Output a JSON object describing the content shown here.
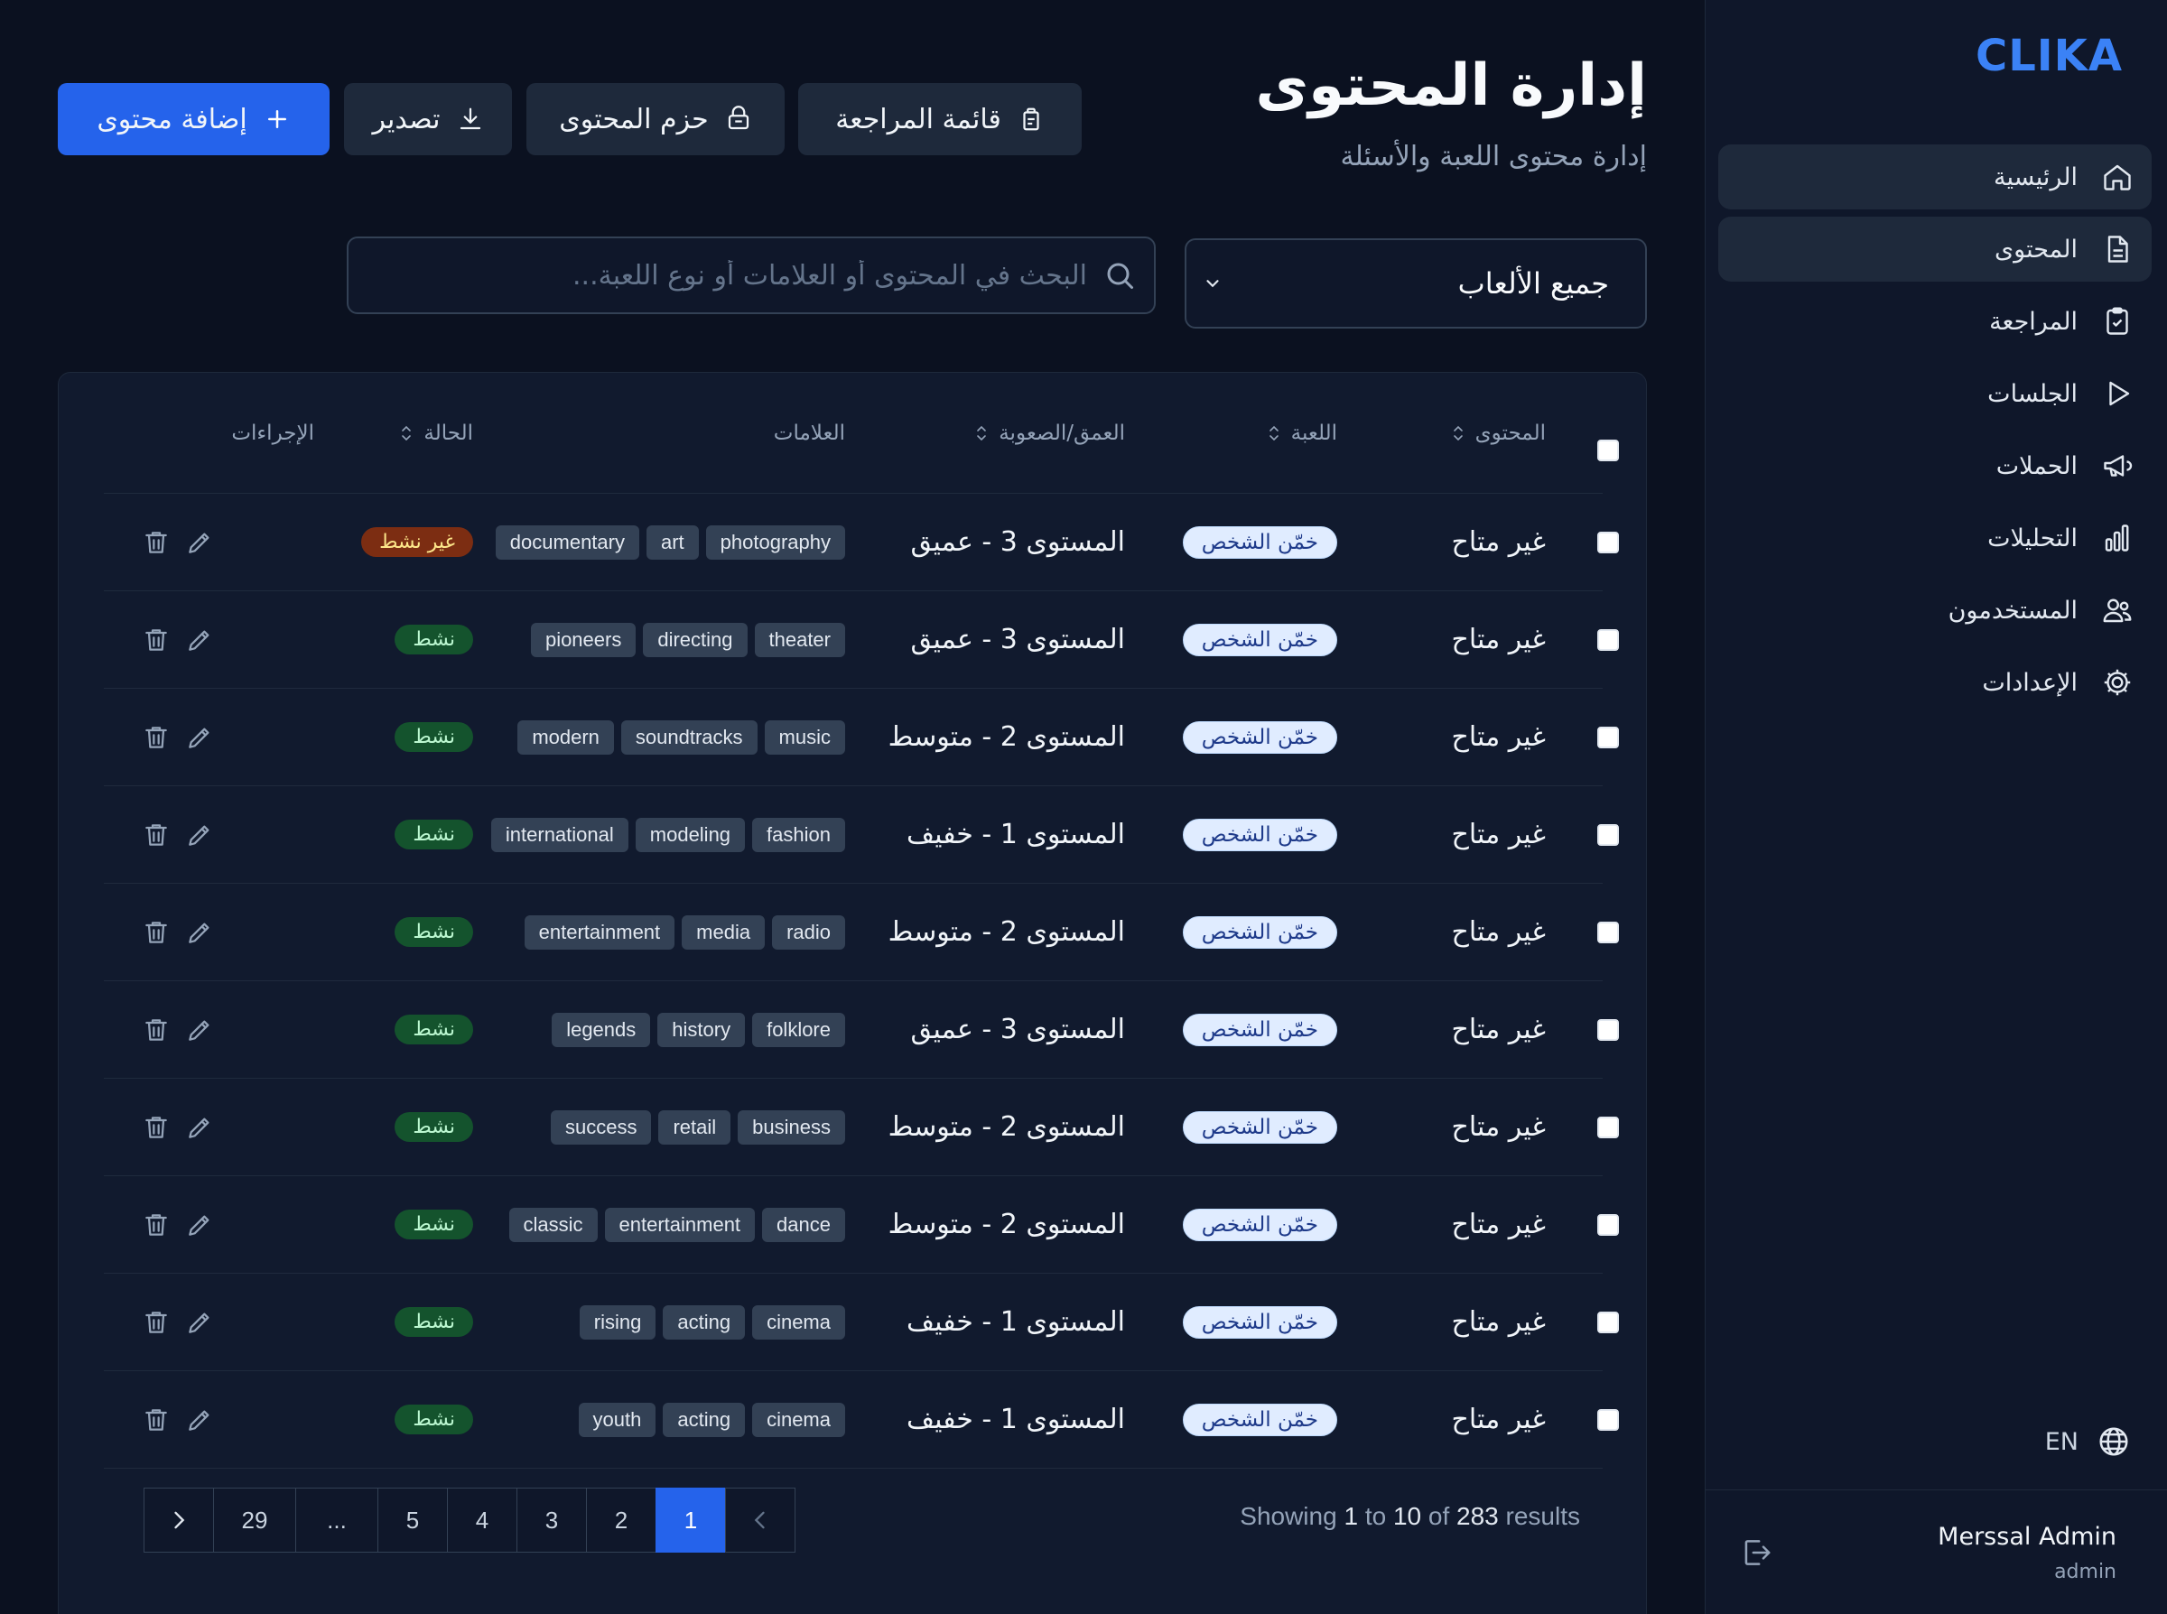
{
  "app": {
    "brand": "CLIKA"
  },
  "sidebar": {
    "items": [
      {
        "label": "الرئيسية",
        "icon": "home-icon"
      },
      {
        "label": "المحتوى",
        "icon": "document-icon"
      },
      {
        "label": "المراجعة",
        "icon": "clipboard-check-icon"
      },
      {
        "label": "الجلسات",
        "icon": "play-icon"
      },
      {
        "label": "الحملات",
        "icon": "megaphone-icon"
      },
      {
        "label": "التحليلات",
        "icon": "bar-chart-icon"
      },
      {
        "label": "المستخدمون",
        "icon": "users-icon"
      },
      {
        "label": "الإعدادات",
        "icon": "gear-icon"
      }
    ],
    "language": "EN",
    "user": {
      "name": "Merssal Admin",
      "role": "admin"
    }
  },
  "header": {
    "title": "إدارة المحتوى",
    "subtitle": "إدارة محتوى اللعبة والأسئلة",
    "buttons": {
      "add": "إضافة محتوى",
      "export": "تصدير",
      "packs": "حزم المحتوى",
      "review_list": "قائمة المراجعة"
    }
  },
  "filters": {
    "game_select": "جميع الألعاب",
    "search_placeholder": "البحث في المحتوى أو العلامات أو نوع اللعبة..."
  },
  "table": {
    "headers": {
      "content": "المحتوى",
      "game": "اللعبة",
      "depth": "العمق/الصعوبة",
      "tags": "العلامات",
      "status": "الحالة",
      "actions": "الإجراءات"
    },
    "rows": [
      {
        "content": "غير متاح",
        "game": "خمّن الشخص",
        "depth": "المستوى 3 - عميق",
        "tags": [
          "photography",
          "art",
          "documentary"
        ],
        "status": "غير نشط",
        "status_type": "inactive"
      },
      {
        "content": "غير متاح",
        "game": "خمّن الشخص",
        "depth": "المستوى 3 - عميق",
        "tags": [
          "theater",
          "directing",
          "pioneers"
        ],
        "status": "نشط",
        "status_type": "active"
      },
      {
        "content": "غير متاح",
        "game": "خمّن الشخص",
        "depth": "المستوى 2 - متوسط",
        "tags": [
          "music",
          "soundtracks",
          "modern"
        ],
        "status": "نشط",
        "status_type": "active"
      },
      {
        "content": "غير متاح",
        "game": "خمّن الشخص",
        "depth": "المستوى 1 - خفيف",
        "tags": [
          "fashion",
          "modeling",
          "international"
        ],
        "status": "نشط",
        "status_type": "active"
      },
      {
        "content": "غير متاح",
        "game": "خمّن الشخص",
        "depth": "المستوى 2 - متوسط",
        "tags": [
          "radio",
          "media",
          "entertainment"
        ],
        "status": "نشط",
        "status_type": "active"
      },
      {
        "content": "غير متاح",
        "game": "خمّن الشخص",
        "depth": "المستوى 3 - عميق",
        "tags": [
          "folklore",
          "history",
          "legends"
        ],
        "status": "نشط",
        "status_type": "active"
      },
      {
        "content": "غير متاح",
        "game": "خمّن الشخص",
        "depth": "المستوى 2 - متوسط",
        "tags": [
          "business",
          "retail",
          "success"
        ],
        "status": "نشط",
        "status_type": "active"
      },
      {
        "content": "غير متاح",
        "game": "خمّن الشخص",
        "depth": "المستوى 2 - متوسط",
        "tags": [
          "dance",
          "entertainment",
          "classic"
        ],
        "status": "نشط",
        "status_type": "active"
      },
      {
        "content": "غير متاح",
        "game": "خمّن الشخص",
        "depth": "المستوى 1 - خفيف",
        "tags": [
          "cinema",
          "acting",
          "rising"
        ],
        "status": "نشط",
        "status_type": "active"
      },
      {
        "content": "غير متاح",
        "game": "خمّن الشخص",
        "depth": "المستوى 1 - خفيف",
        "tags": [
          "cinema",
          "acting",
          "youth"
        ],
        "status": "نشط",
        "status_type": "active"
      }
    ]
  },
  "pagination": {
    "pages": [
      "29",
      "...",
      "5",
      "4",
      "3",
      "2",
      "1"
    ],
    "current": "1",
    "summary": {
      "prefix": "Showing",
      "from": "1",
      "to_word": "to",
      "to": "10",
      "of_word": "of",
      "total": "283",
      "suffix": "results"
    }
  },
  "colors": {
    "accent": "#2563eb",
    "brand": "#3b82f6",
    "active_status": "#14532d",
    "inactive_status": "#7c2d12"
  }
}
